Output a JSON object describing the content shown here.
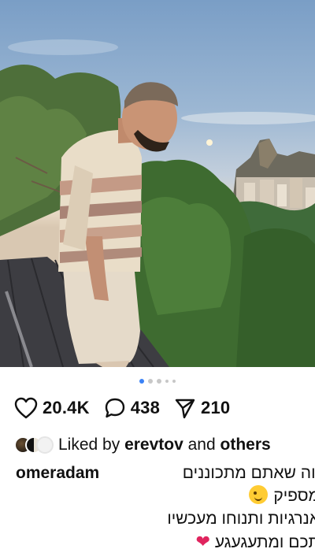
{
  "post": {
    "carousel": {
      "total_dots": 5,
      "active_index": 0
    },
    "actions": {
      "likes": "20.4K",
      "comments": "438",
      "shares": "210"
    },
    "liked_by": {
      "prefix": "Liked by",
      "user": "erevtov",
      "connector": "and",
      "others": "others"
    },
    "caption": {
      "username": "omeradam",
      "line1": "ווה שאתם מתכוננים",
      "line2": "מספיק",
      "line3": "אנרגיות ותנוחו מעכשיו",
      "line4": "תכם ומתעגעגע"
    }
  },
  "icons": {
    "like": "heart-outline-icon",
    "comment": "speech-bubble-icon",
    "share": "paper-plane-icon",
    "wink": "winking-face-emoji",
    "heart": "red-heart-emoji"
  },
  "colors": {
    "active_dot": "#3b82f6",
    "text": "#111111",
    "heart_emoji": "#e0245e"
  }
}
